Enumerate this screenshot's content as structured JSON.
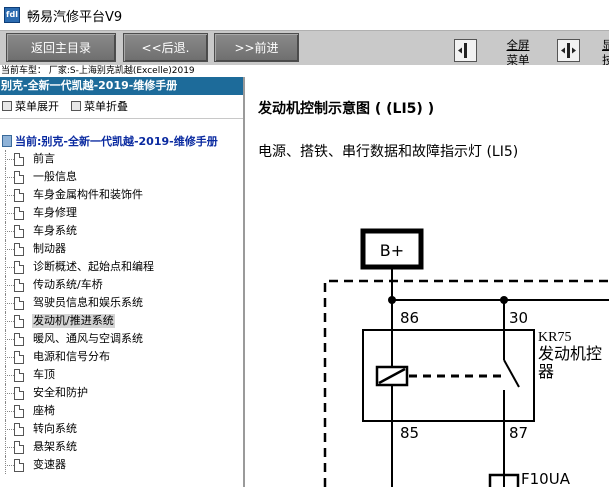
{
  "window": {
    "app_icon_text": "fdl",
    "title": "畅易汽修平台V9"
  },
  "toolbar": {
    "main_menu_label": "返回主目录",
    "back_label": "<<后退.",
    "forward_label": ">>前进",
    "fullscreen_label_line1": "全屏",
    "fullscreen_label_line2": "菜单",
    "expand_label_line1": "显",
    "expand_label_line2": "技"
  },
  "vehicle_info": "当前车型： 厂家:S-上海别克凯越(Excelle)2019",
  "sidebar": {
    "manual_header": "别克-全新一代凯越-2019-维修手册",
    "menu_expand": "菜单展开",
    "menu_collapse": "菜单折叠",
    "current_label": "当前:别克-全新一代凯越-2019-维修手册",
    "items": [
      {
        "label": "前言"
      },
      {
        "label": "一般信息"
      },
      {
        "label": "车身金属构件和装饰件"
      },
      {
        "label": "车身修理"
      },
      {
        "label": "车身系统"
      },
      {
        "label": "制动器"
      },
      {
        "label": "诊断概述、起始点和编程"
      },
      {
        "label": "传动系统/车桥"
      },
      {
        "label": "驾驶员信息和娱乐系统"
      },
      {
        "label": "发动机/推进系统",
        "selected": true
      },
      {
        "label": "暖风、通风与空调系统"
      },
      {
        "label": "电源和信号分布"
      },
      {
        "label": "车顶"
      },
      {
        "label": "安全和防护"
      },
      {
        "label": "座椅"
      },
      {
        "label": "转向系统"
      },
      {
        "label": "悬架系统"
      },
      {
        "label": "变速器"
      }
    ]
  },
  "content": {
    "title": "发动机控制示意图 ( (LI5) )",
    "subtitle": "电源、搭铁、串行数据和故障指示灯 (LI5)",
    "schematic": {
      "supply_label": "B+",
      "pin_86": "86",
      "pin_30": "30",
      "pin_85": "85",
      "pin_87": "87",
      "relay_id": "KR75",
      "relay_name_line1": "发动机控",
      "relay_name_line2": "器",
      "fuse_label": "F10UA"
    }
  }
}
